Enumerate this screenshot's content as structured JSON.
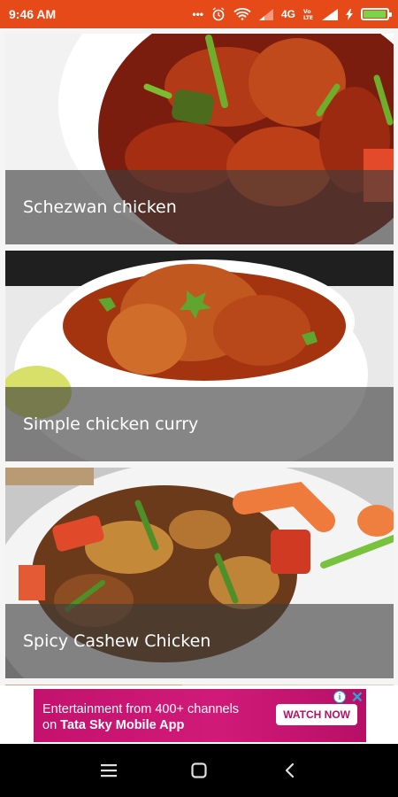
{
  "status_bar": {
    "time": "9:46 AM",
    "network": "4G",
    "battery_level": 0.95,
    "background": "#e64a19"
  },
  "recipes": [
    {
      "title": "Schezwan chicken"
    },
    {
      "title": "Simple chicken curry"
    },
    {
      "title": "Spicy Cashew Chicken"
    }
  ],
  "ad": {
    "text_line1": "Entertainment from 400+ channels",
    "text_line2_prefix": "on ",
    "text_line2_bold": "Tata Sky Mobile App",
    "cta": "WATCH NOW",
    "info_glyph": "i",
    "close_glyph": "✕"
  },
  "nav": {
    "recents_icon": "recent-apps-icon",
    "home_icon": "home-icon",
    "back_icon": "back-icon"
  }
}
